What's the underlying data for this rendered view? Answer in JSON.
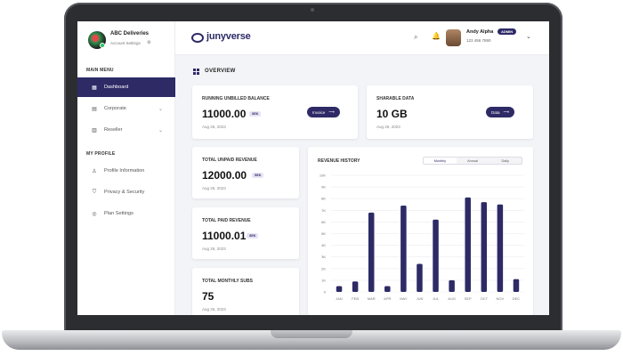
{
  "sidebar": {
    "account_name": "ABC Deliveries",
    "account_sub": "Account Settings",
    "main_menu_label": "MAIN MENU",
    "main_items": [
      {
        "label": "Dashboard",
        "icon": "dashboard-icon"
      },
      {
        "label": "Corporate",
        "icon": "building-icon"
      },
      {
        "label": "Reseller",
        "icon": "store-icon"
      }
    ],
    "profile_label": "MY PROFILE",
    "profile_items": [
      {
        "label": "Profile Information",
        "icon": "user-icon"
      },
      {
        "label": "Privacy & Security",
        "icon": "shield-icon"
      },
      {
        "label": "Plan Settings",
        "icon": "globe-icon"
      }
    ]
  },
  "header": {
    "brand": "junyverse",
    "user_name": "Andy Alpha",
    "user_role": "ADMIN",
    "user_phone": "123 456 7890"
  },
  "overview": {
    "title": "OVERVIEW",
    "cards": [
      {
        "label": "RUNNING UNBILLED BALANCE",
        "value": "11000.00",
        "tag": "SEK",
        "date": "Aug 26, 2023",
        "button": "Invoice"
      },
      {
        "label": "SHARABLE DATA",
        "value": "10 GB",
        "date": "Aug 26, 2023",
        "button": "Data"
      },
      {
        "label": "TOTAL UNPAID REVENUE",
        "value": "12000.00",
        "tag": "SEK",
        "date": "Aug 26, 2023"
      },
      {
        "label": "TOTAL PAID REVENUE",
        "value": "11000.01",
        "tag": "SEK",
        "date": "Aug 26, 2023"
      },
      {
        "label": "TOTAL MONTHLY SUBS",
        "value": "75",
        "date": "Aug 26, 2023"
      }
    ]
  },
  "revenue_history": {
    "title": "REVENUE HISTORY",
    "tabs": [
      "Monthly",
      "Annual",
      "Daily"
    ],
    "active_tab": "Monthly"
  },
  "chart_data": {
    "type": "bar",
    "title": "REVENUE HISTORY",
    "categories": [
      "JAN",
      "FEB",
      "MAR",
      "APR",
      "MAY",
      "JUN",
      "JUL",
      "AUG",
      "SEP",
      "OCT",
      "NOV",
      "DEC"
    ],
    "values": [
      500,
      900,
      6800,
      500,
      7400,
      2400,
      6200,
      1000,
      8100,
      7700,
      7500,
      1100
    ],
    "ylim": [
      0,
      10000
    ],
    "yticks": [
      "0",
      "1K",
      "2K",
      "3K",
      "4K",
      "5K",
      "6K",
      "7K",
      "8K",
      "9K",
      "10K"
    ],
    "grid": true,
    "bar_color": "#2d2a66"
  },
  "colors": {
    "accent": "#2d2a66",
    "online": "#27c25f"
  }
}
